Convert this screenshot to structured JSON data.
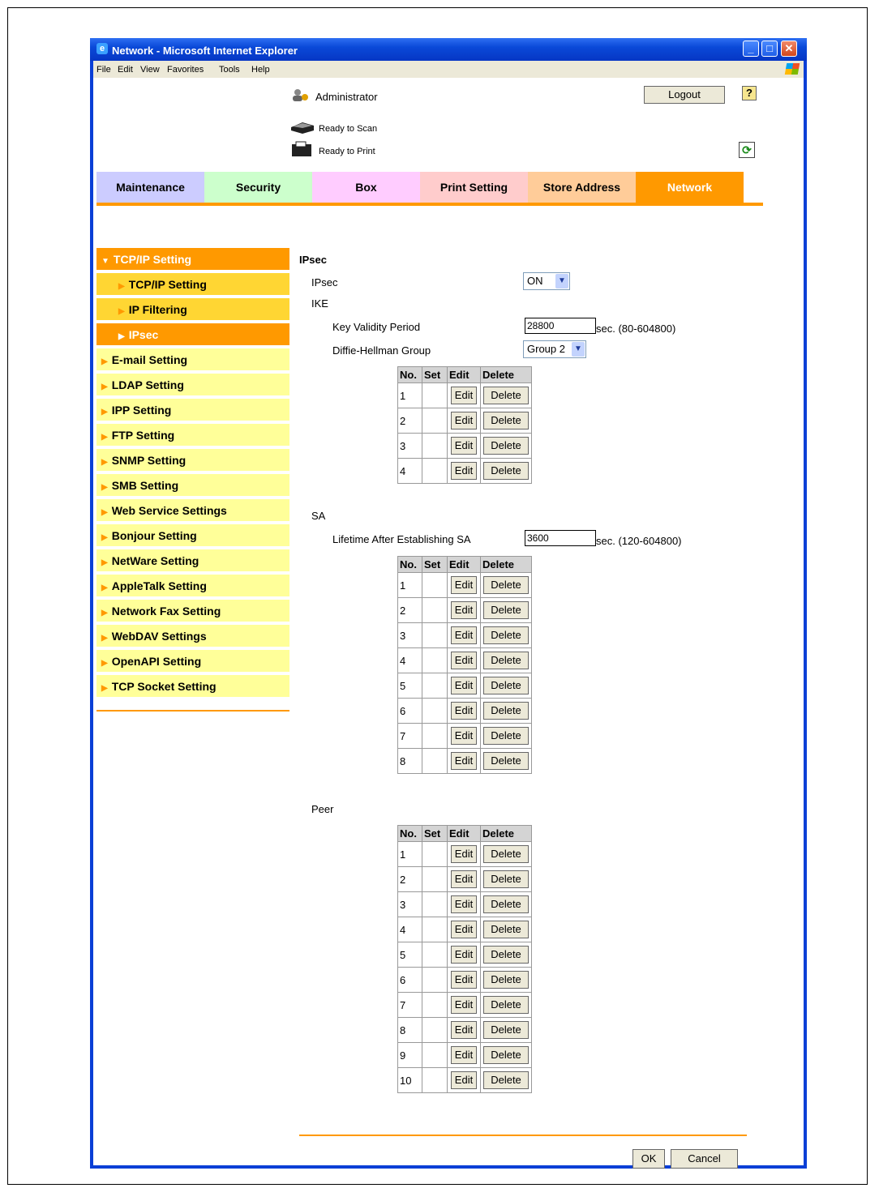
{
  "window": {
    "title": "Network - Microsoft Internet Explorer",
    "menu": [
      "File",
      "Edit",
      "View",
      "Favorites",
      "Tools",
      "Help"
    ]
  },
  "header": {
    "user": "Administrator",
    "logout_label": "Logout",
    "help_label": "?",
    "status": [
      "Ready to Scan",
      "Ready to Print"
    ]
  },
  "tabs": [
    {
      "label": "Maintenance",
      "color": "#ccccff"
    },
    {
      "label": "Security",
      "color": "#ccffcc"
    },
    {
      "label": "Box",
      "color": "#ffccff"
    },
    {
      "label": "Print Setting",
      "color": "#ffcccc"
    },
    {
      "label": "Store Address",
      "color": "#ffcc99"
    },
    {
      "label": "Network",
      "color": "#ff9900",
      "active": true
    }
  ],
  "sidebar": {
    "items": [
      {
        "label": "TCP/IP Setting",
        "state": "selected",
        "expanded": true
      },
      {
        "label": "TCP/IP Setting",
        "state": "sub"
      },
      {
        "label": "IP Filtering",
        "state": "sub"
      },
      {
        "label": "IPsec",
        "state": "sub-selected"
      },
      {
        "label": "E-mail Setting"
      },
      {
        "label": "LDAP Setting"
      },
      {
        "label": "IPP Setting"
      },
      {
        "label": "FTP Setting"
      },
      {
        "label": "SNMP Setting"
      },
      {
        "label": "SMB Setting"
      },
      {
        "label": "Web Service Settings"
      },
      {
        "label": "Bonjour Setting"
      },
      {
        "label": "NetWare Setting"
      },
      {
        "label": "AppleTalk Setting"
      },
      {
        "label": "Network Fax Setting"
      },
      {
        "label": "WebDAV Settings"
      },
      {
        "label": "OpenAPI Setting"
      },
      {
        "label": "TCP Socket Setting"
      }
    ]
  },
  "form": {
    "title": "IPsec",
    "ipsec_label": "IPsec",
    "ipsec_value": "ON",
    "ike_label": "IKE",
    "key_validity_label": "Key Validity Period",
    "key_validity_value": "28800",
    "key_validity_range": "sec. (80-604800)",
    "dh_group_label": "Diffie-Hellman Group",
    "dh_group_value": "Group 2",
    "sa_label": "SA",
    "lifetime_label": "Lifetime After Establishing SA",
    "lifetime_value": "3600",
    "lifetime_range": "sec. (120-604800)",
    "peer_label": "Peer",
    "table_headers": [
      "No.",
      "Set",
      "Edit",
      "Delete"
    ],
    "edit_label": "Edit",
    "delete_label": "Delete",
    "ike_rows": [
      "1",
      "2",
      "3",
      "4"
    ],
    "sa_rows": [
      "1",
      "2",
      "3",
      "4",
      "5",
      "6",
      "7",
      "8"
    ],
    "peer_rows": [
      "1",
      "2",
      "3",
      "4",
      "5",
      "6",
      "7",
      "8",
      "9",
      "10"
    ],
    "ok_label": "OK",
    "cancel_label": "Cancel"
  }
}
